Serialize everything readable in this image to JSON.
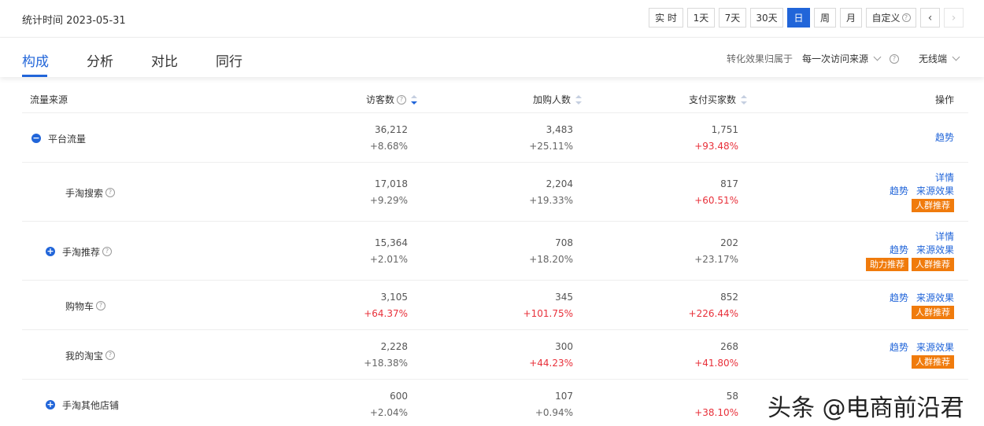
{
  "header": {
    "stat_label": "统计时间 2023-05-31",
    "ranges": [
      "实 时",
      "1天",
      "7天",
      "30天",
      "日",
      "周",
      "月",
      "自定义"
    ],
    "active_range": "日",
    "prev_icon": "chevron-left-icon",
    "next_icon": "chevron-right-icon"
  },
  "tabs": {
    "items": [
      "构成",
      "分析",
      "对比",
      "同行"
    ],
    "active": "构成",
    "attribution_label": "转化效果归属于",
    "attribution_value": "每一次访问来源",
    "device_value": "无线端"
  },
  "table": {
    "headers": {
      "source": "流量来源",
      "visitors": "访客数",
      "cart": "加购人数",
      "buyers": "支付买家数",
      "ops": "操作"
    },
    "rows": [
      {
        "name": "平台流量",
        "expand": "minus",
        "help": false,
        "visitors": "36,212",
        "visitors_d": "+8.68%",
        "visitors_red": false,
        "cart": "3,483",
        "cart_d": "+25.11%",
        "cart_red": false,
        "buyers": "1,751",
        "buyers_d": "+93.48%",
        "buyers_red": true,
        "ops": {
          "detail": "",
          "trend": "趋势",
          "effect": "",
          "tags": []
        }
      },
      {
        "name": "手淘搜索",
        "expand": "",
        "help": true,
        "visitors": "17,018",
        "visitors_d": "+9.29%",
        "visitors_red": false,
        "cart": "2,204",
        "cart_d": "+19.33%",
        "cart_red": false,
        "buyers": "817",
        "buyers_d": "+60.51%",
        "buyers_red": true,
        "ops": {
          "detail": "详情",
          "trend": "趋势",
          "effect": "来源效果",
          "tags": [
            "人群推荐"
          ]
        }
      },
      {
        "name": "手淘推荐",
        "expand": "plus",
        "help": true,
        "visitors": "15,364",
        "visitors_d": "+2.01%",
        "visitors_red": false,
        "cart": "708",
        "cart_d": "+18.20%",
        "cart_red": false,
        "buyers": "202",
        "buyers_d": "+23.17%",
        "buyers_red": false,
        "ops": {
          "detail": "详情",
          "trend": "趋势",
          "effect": "来源效果",
          "tags": [
            "助力推荐",
            "人群推荐"
          ]
        }
      },
      {
        "name": "购物车",
        "expand": "",
        "help": true,
        "visitors": "3,105",
        "visitors_d": "+64.37%",
        "visitors_red": true,
        "cart": "345",
        "cart_d": "+101.75%",
        "cart_red": true,
        "buyers": "852",
        "buyers_d": "+226.44%",
        "buyers_red": true,
        "ops": {
          "detail": "",
          "trend": "趋势",
          "effect": "来源效果",
          "tags": [
            "人群推荐"
          ]
        }
      },
      {
        "name": "我的淘宝",
        "expand": "",
        "help": true,
        "visitors": "2,228",
        "visitors_d": "+18.38%",
        "visitors_red": false,
        "cart": "300",
        "cart_d": "+44.23%",
        "cart_red": true,
        "buyers": "268",
        "buyers_d": "+41.80%",
        "buyers_red": true,
        "ops": {
          "detail": "",
          "trend": "趋势",
          "effect": "来源效果",
          "tags": [
            "人群推荐"
          ]
        }
      },
      {
        "name": "手淘其他店铺",
        "expand": "plus",
        "help": false,
        "visitors": "600",
        "visitors_d": "+2.04%",
        "visitors_red": false,
        "cart": "107",
        "cart_d": "+0.94%",
        "cart_red": false,
        "buyers": "58",
        "buyers_d": "+38.10%",
        "buyers_red": true,
        "ops": {
          "detail": "",
          "trend": "",
          "effect": "",
          "tags": []
        }
      }
    ]
  },
  "watermark": "头条 @电商前沿君",
  "colors": {
    "accent": "#2165d9",
    "red": "#e8303a",
    "tag": "#f07b0c"
  }
}
